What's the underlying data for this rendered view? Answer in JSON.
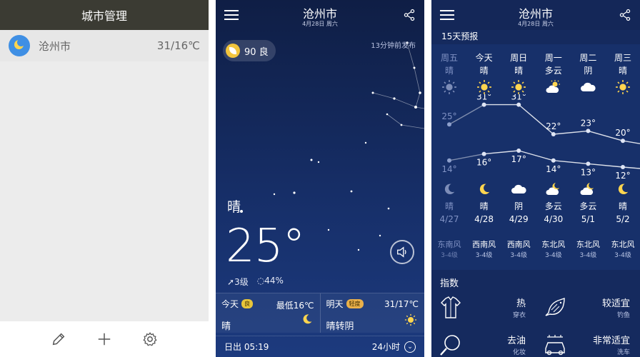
{
  "panel1": {
    "title": "城市管理",
    "city": {
      "name": "沧州市",
      "temp": "31/16℃"
    },
    "toolbar": {
      "edit": "edit",
      "add": "add",
      "settings": "settings"
    }
  },
  "panel2": {
    "city": "沧州市",
    "date": "4月28日 周六",
    "aqi": "90 良",
    "published": "13分钟前发布",
    "condition": "晴",
    "temperature": "25°",
    "wind": "3级",
    "humidity": "44%",
    "today": {
      "label": "今天",
      "badge": "良",
      "low": "最低16℃",
      "cond": "晴"
    },
    "tomorrow": {
      "label": "明天",
      "badge": "轻度",
      "temp": "31/17℃",
      "cond": "晴转阴"
    },
    "sunrise": "日出 05:19",
    "hours_label": "24小时"
  },
  "panel3": {
    "city": "沧州市",
    "date": "4月28日 周六",
    "subtitle": "15天预报",
    "days": [
      {
        "day": "周五",
        "wday": "晴",
        "hi": "25°",
        "lo": "14°",
        "nw": "晴",
        "date": "4/27",
        "wd": "东南风",
        "wl": "3-4级",
        "past": true,
        "dicon": "sun",
        "nicon": "moon"
      },
      {
        "day": "今天",
        "wday": "晴",
        "hi": "31°",
        "lo": "16°",
        "nw": "晴",
        "date": "4/28",
        "wd": "西南风",
        "wl": "3-4级",
        "past": false,
        "dicon": "sun",
        "nicon": "moon"
      },
      {
        "day": "周日",
        "wday": "晴",
        "hi": "31°",
        "lo": "17°",
        "nw": "阴",
        "date": "4/29",
        "wd": "西南风",
        "wl": "3-4级",
        "past": false,
        "dicon": "sun",
        "nicon": "cloud"
      },
      {
        "day": "周一",
        "wday": "多云",
        "hi": "22°",
        "lo": "14°",
        "nw": "多云",
        "date": "4/30",
        "wd": "东北风",
        "wl": "3-4级",
        "past": false,
        "dicon": "partly",
        "nicon": "partlymoon"
      },
      {
        "day": "周二",
        "wday": "阴",
        "hi": "23°",
        "lo": "13°",
        "nw": "多云",
        "date": "5/1",
        "wd": "东北风",
        "wl": "3-4级",
        "past": false,
        "dicon": "cloud",
        "nicon": "partlymoon"
      },
      {
        "day": "周三",
        "wday": "晴",
        "hi": "20°",
        "lo": "12°",
        "nw": "晴",
        "date": "5/2",
        "wd": "东北风",
        "wl": "3-4级",
        "past": false,
        "dicon": "sun",
        "nicon": "moon"
      }
    ],
    "chart_data": {
      "type": "line",
      "x": [
        "4/27",
        "4/28",
        "4/29",
        "4/30",
        "5/1",
        "5/2"
      ],
      "series": [
        {
          "values": [
            25,
            31,
            31,
            22,
            23,
            20
          ]
        },
        {
          "values": [
            14,
            16,
            17,
            14,
            13,
            12
          ]
        }
      ]
    },
    "index_title": "指数",
    "indices": [
      {
        "label": "热",
        "sub": "穿衣",
        "icon": "shirt-icon"
      },
      {
        "label": "较适宜",
        "sub": "钓鱼",
        "icon": "fish-icon"
      },
      {
        "label": "去油",
        "sub": "化妆",
        "icon": "magnifier-icon"
      },
      {
        "label": "非常适宜",
        "sub": "洗车",
        "icon": "car-icon"
      }
    ]
  }
}
